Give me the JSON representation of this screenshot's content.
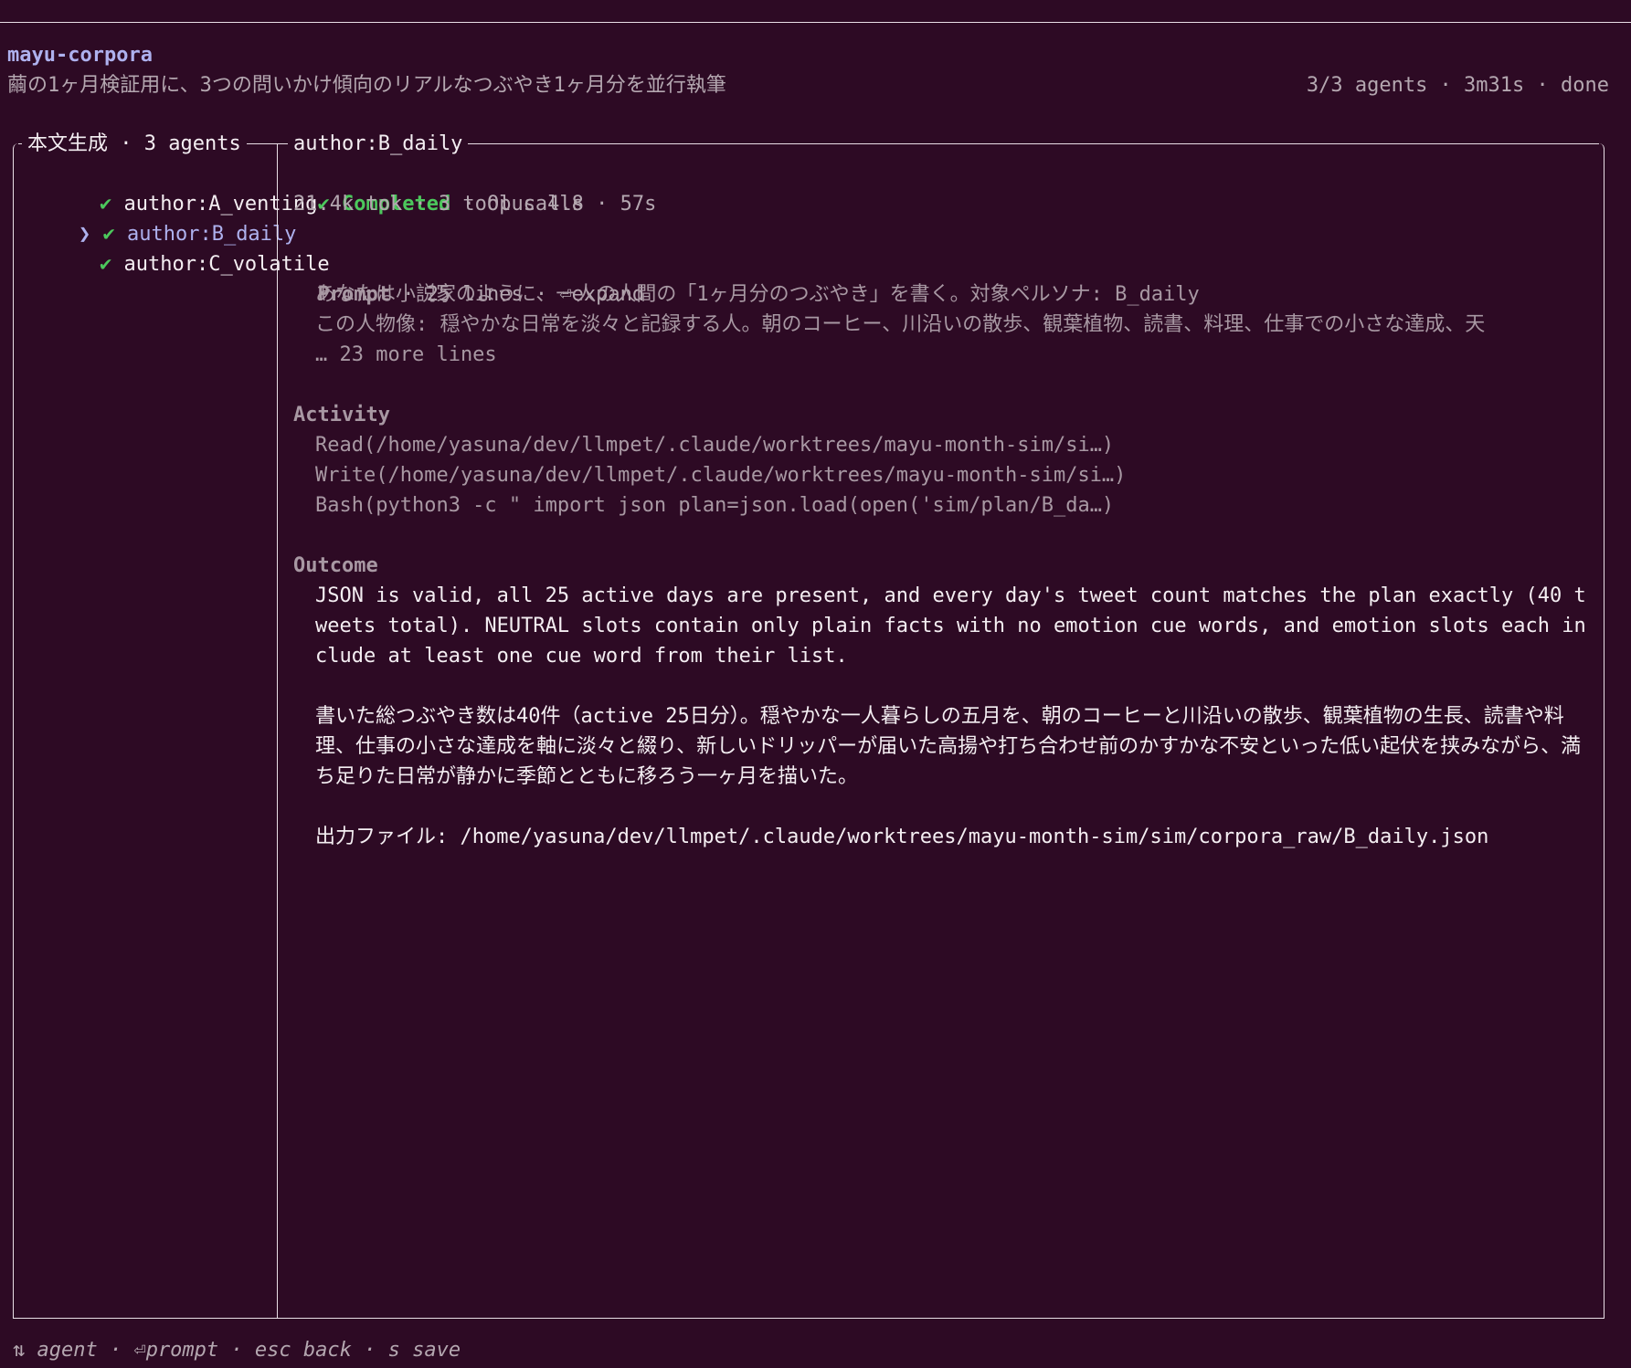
{
  "header": {
    "app_title": "mayu-corpora",
    "subtitle": "繭の1ヶ月検証用に、3つの問いかけ傾向のリアルなつぶやき1ヶ月分を並行執筆",
    "status": "3/3 agents · 3m31s · done"
  },
  "sidebar": {
    "title": "本文生成 · 3 agents",
    "selected_marker": "❯",
    "check_glyph": "✔",
    "items": [
      {
        "label": "author:A_venting",
        "selected": false
      },
      {
        "label": "author:B_daily",
        "selected": true
      },
      {
        "label": "author:C_volatile",
        "selected": false
      }
    ]
  },
  "detail": {
    "title": "author:B_daily",
    "status_label": "Completed",
    "status_icon": "✔",
    "model": " · Opus 4.8",
    "stats": "21.4k tok · 3 tool calls · 57s",
    "prompt": {
      "heading": "Prompt",
      "meta": " · 25 lines · ⏎expand",
      "lines": [
        "あなたは小説家のように、一人の人間の「1ヶ月分のつぶやき」を書く。対象ペルソナ: B_daily",
        "この人物像: 穏やかな日常を淡々と記録する人。朝のコーヒー、川沿いの散歩、観葉植物、読書、料理、仕事での小さな達成、天",
        "… 23 more lines"
      ]
    },
    "activity": {
      "heading": "Activity",
      "items": [
        "Read(/home/yasuna/dev/llmpet/.claude/worktrees/mayu-month-sim/si…)",
        "Write(/home/yasuna/dev/llmpet/.claude/worktrees/mayu-month-sim/si…)",
        "Bash(python3 -c \" import json plan=json.load(open('sim/plan/B_da…)"
      ]
    },
    "outcome": {
      "heading": "Outcome",
      "paragraph_en": "JSON is valid, all 25 active days are present, and every day's tweet count matches the plan exactly (40 tweets total). NEUTRAL slots contain only plain facts with no emotion cue words, and emotion slots each include at least one cue word from their list.",
      "paragraph_ja": "書いた総つぶやき数は40件（active 25日分）。穏やかな一人暮らしの五月を、朝のコーヒーと川沿いの散歩、観葉植物の生長、読書や料理、仕事の小さな達成を軸に淡々と綴り、新しいドリッパーが届いた高揚や打ち合わせ前のかすかな不安といった低い起伏を挟みながら、満ち足りた日常が静かに季節とともに移ろう一ヶ月を描いた。",
      "output_file": "出力ファイル: /home/yasuna/dev/llmpet/.claude/worktrees/mayu-month-sim/sim/corpora_raw/B_daily.json"
    }
  },
  "footer": {
    "hints": "⇅ agent · ⏎prompt · esc back · s save"
  },
  "colors": {
    "background": "#2d0a24",
    "accent": "#aeb1ee",
    "success": "#4cc85c",
    "border": "#e9dfe6"
  }
}
